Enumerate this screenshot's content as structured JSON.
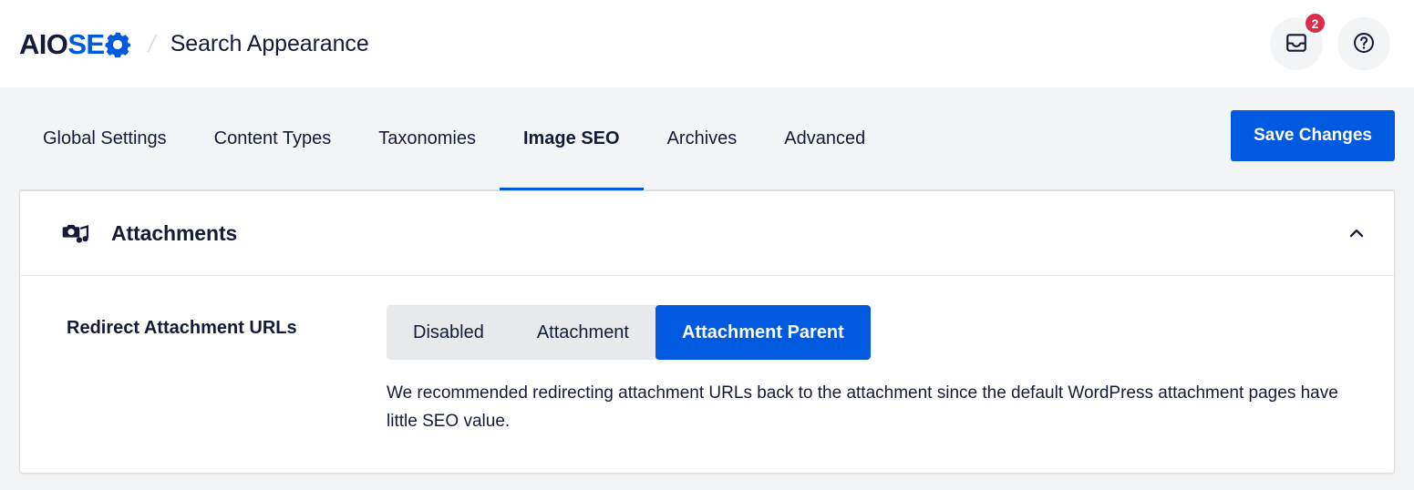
{
  "header": {
    "logo": {
      "part_dark": "AIO",
      "part_blue": "SE",
      "gear_icon": "gear-o-icon"
    },
    "divider": "/",
    "page_title": "Search Appearance",
    "actions": [
      {
        "name": "notifications-button",
        "icon": "inbox-icon",
        "badge": "2"
      },
      {
        "name": "help-button",
        "icon": "question-circle-icon",
        "badge": null
      }
    ]
  },
  "tabs": [
    {
      "label": "Global Settings",
      "active": false
    },
    {
      "label": "Content Types",
      "active": false
    },
    {
      "label": "Taxonomies",
      "active": false
    },
    {
      "label": "Image SEO",
      "active": true
    },
    {
      "label": "Archives",
      "active": false
    },
    {
      "label": "Advanced",
      "active": false
    }
  ],
  "toolbar": {
    "save_label": "Save Changes"
  },
  "card": {
    "icon": "attachments-media-icon",
    "title": "Attachments",
    "collapse_icon": "chevron-up-icon",
    "setting": {
      "label": "Redirect Attachment URLs",
      "options": [
        {
          "label": "Disabled",
          "selected": false
        },
        {
          "label": "Attachment",
          "selected": false
        },
        {
          "label": "Attachment Parent",
          "selected": true
        }
      ],
      "selected_value": "Attachment Parent",
      "description": "We recommended redirecting attachment URLs back to the attachment since the default WordPress attachment pages have little SEO value."
    }
  },
  "colors": {
    "brand_blue": "#005ae0",
    "dark_navy": "#141b38",
    "badge_red": "#df2a4a",
    "page_bg": "#f3f4f5",
    "segment_bg": "#e8e9eb",
    "border": "#dcdde1"
  }
}
